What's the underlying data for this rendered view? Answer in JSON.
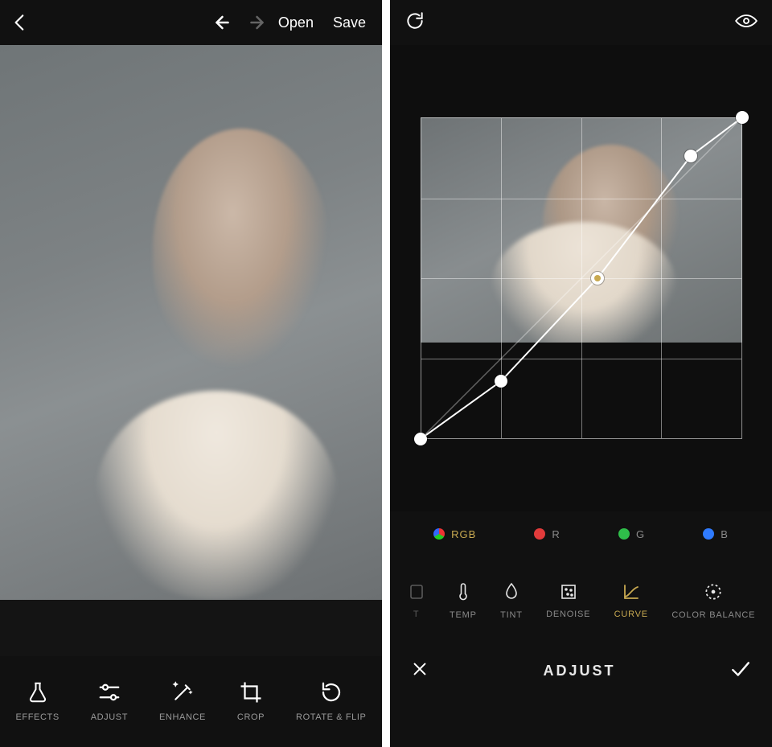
{
  "left": {
    "top": {
      "open": "Open",
      "save": "Save"
    },
    "tools": [
      {
        "id": "effects",
        "label": "EFFECTS"
      },
      {
        "id": "adjust",
        "label": "ADJUST"
      },
      {
        "id": "enhance",
        "label": "ENHANCE"
      },
      {
        "id": "crop",
        "label": "CROP"
      },
      {
        "id": "rotate-flip",
        "label": "ROTATE & FLIP"
      }
    ]
  },
  "right": {
    "channels": [
      {
        "id": "rgb",
        "label": "RGB",
        "active": true
      },
      {
        "id": "r",
        "label": "R"
      },
      {
        "id": "g",
        "label": "G"
      },
      {
        "id": "b",
        "label": "B"
      }
    ],
    "adjust_tools": [
      {
        "id": "truncated",
        "label": "T",
        "edge": true
      },
      {
        "id": "temp",
        "label": "TEMP"
      },
      {
        "id": "tint",
        "label": "TINT"
      },
      {
        "id": "denoise",
        "label": "DENOISE"
      },
      {
        "id": "curve",
        "label": "CURVE",
        "active": true
      },
      {
        "id": "color-balance",
        "label": "COLOR BALANCE"
      }
    ],
    "bottom_title": "ADJUST",
    "curve_points": [
      {
        "x": 0.0,
        "y": 1.0
      },
      {
        "x": 0.25,
        "y": 0.82
      },
      {
        "x": 0.55,
        "y": 0.5,
        "selected": true
      },
      {
        "x": 0.84,
        "y": 0.12
      },
      {
        "x": 1.0,
        "y": 0.0
      }
    ]
  }
}
